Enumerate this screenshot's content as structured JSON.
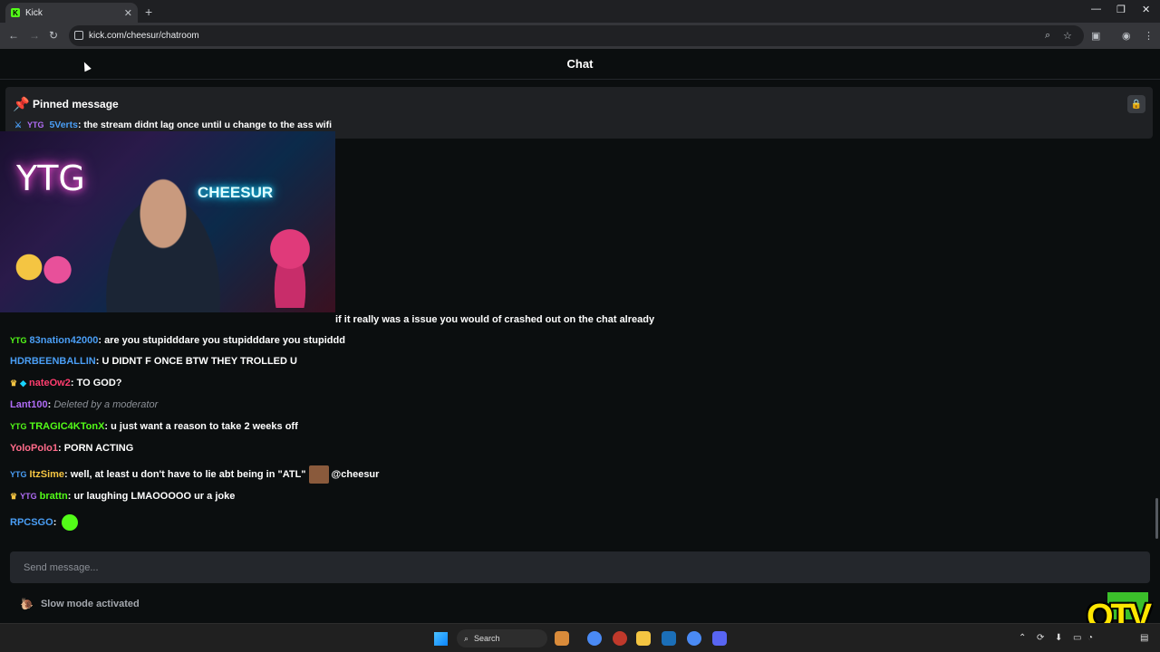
{
  "browser": {
    "tab_title": "Kick",
    "tab_favicon": "K",
    "url": "kick.com/cheesur/chatroom"
  },
  "chat": {
    "header_title": "Chat",
    "pinned": {
      "title": "Pinned message",
      "user": "5Verts",
      "user_color": "#4a9ef5",
      "text": ": the stream didnt lag once until u change to the ass wifi"
    },
    "webcam_overlay": {
      "neon_text_1": "YTG",
      "neon_text_2": "CHEESUR"
    },
    "messages": [
      {
        "user": "",
        "user_color": "#f5c542",
        "text": "if it really was a issue you would of crashed out on the chat already",
        "badges": [
          "crown-icon",
          "gem-icon"
        ]
      },
      {
        "user": "83nation42000",
        "user_color": "#4a9ef5",
        "text": ": are you stupidddare you stupidddare you stupiddd",
        "badges": [
          "ytg-badge-icon"
        ]
      },
      {
        "user": "HDRBEENBALLIN",
        "user_color": "#4a9ef5",
        "text": ": U DIDNT F ONCE BTW THEY TROLLED U",
        "badges": []
      },
      {
        "user": "nateOw2",
        "user_color": "#ff3d6e",
        "text": ": TO GOD?",
        "badges": [
          "crown-icon",
          "gem-icon"
        ]
      },
      {
        "user": "Lant100",
        "user_color": "#b06cf5",
        "text": "Deleted by a moderator",
        "deleted": true,
        "badges": []
      },
      {
        "user": "TRAGIC4KTonX",
        "user_color": "#53fc18",
        "text": ": u just want a reason to take 2 weeks off",
        "badges": [
          "ytg-badge-icon"
        ]
      },
      {
        "user": "YoloPolo1",
        "user_color": "#ff6b8a",
        "text": ": PORN ACTING",
        "badges": []
      },
      {
        "user": "ItzSime",
        "user_color": "#f5c542",
        "text": ": well, at least u don't have to lie abt being in \"ATL\"",
        "mention": "@cheesur",
        "badges": [
          "ytg-badge-icon"
        ]
      },
      {
        "user": "brattn",
        "user_color": "#53fc18",
        "text": ": ur laughing LMAOOOOO ur a joke",
        "badges": [
          "crown-icon",
          "ytg-badge-icon"
        ]
      },
      {
        "user": "RPCSGO",
        "user_color": "#4a9ef5",
        "text": ":",
        "badges": []
      }
    ],
    "input_placeholder": "Send message...",
    "slow_mode_text": "Slow mode activated"
  },
  "overlay": {
    "logo_text": "OTV"
  },
  "taskbar": {
    "search_label": "Search"
  },
  "colors": {
    "accent": "#53fc18",
    "background": "#0b0e0f",
    "panel": "#1f2124"
  }
}
